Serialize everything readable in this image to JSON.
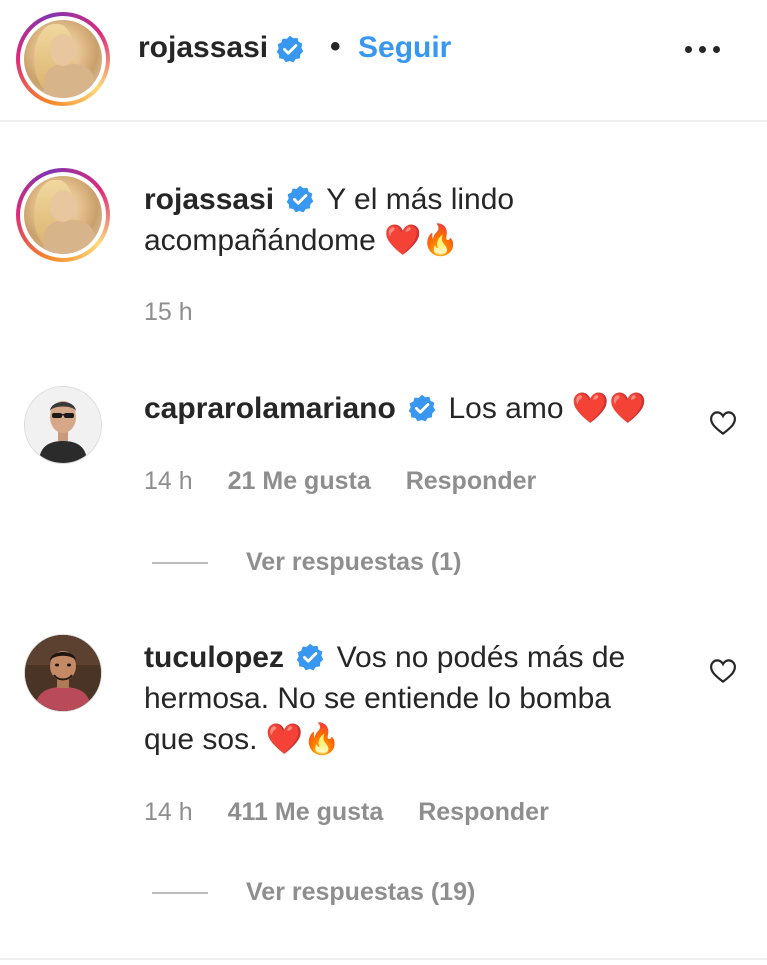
{
  "header": {
    "username": "rojassasi",
    "separator": "•",
    "follow_label": "Seguir"
  },
  "caption": {
    "username": "rojassasi",
    "text_line1": "Y el más lindo",
    "text_line2": "acompañándome",
    "emoji": "❤️🔥",
    "time": "15 h"
  },
  "comments": [
    {
      "username": "caprarolamariano",
      "text": "Los amo",
      "emoji": "❤️❤️",
      "time": "14 h",
      "likes": "21 Me gusta",
      "reply_label": "Responder",
      "view_replies": "Ver respuestas (1)"
    },
    {
      "username": "tuculopez",
      "text_line1": "Vos no podés más de",
      "text_line2": "hermosa. No se entiende lo bomba",
      "text_line3": "que sos.",
      "emoji": "❤️🔥",
      "time": "14 h",
      "likes": "411 Me gusta",
      "reply_label": "Responder",
      "view_replies": "Ver respuestas (19)"
    }
  ],
  "colors": {
    "link_blue": "#3897f0",
    "verified_blue": "#3897f0",
    "text_dark": "#262626",
    "meta_gray": "#8e8e8e"
  },
  "icons": [
    "verified-badge-icon",
    "more-options-icon",
    "like-heart-icon"
  ]
}
